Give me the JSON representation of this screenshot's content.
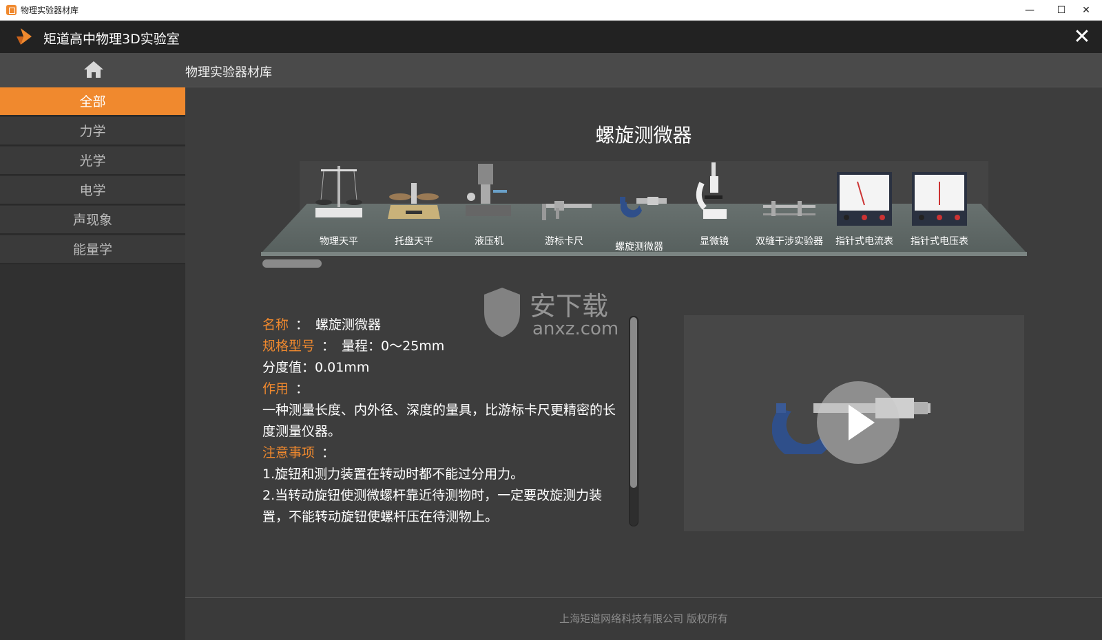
{
  "window": {
    "title": "物理实验器材库",
    "controls": [
      "minimize-icon",
      "maximize-icon",
      "close-icon"
    ]
  },
  "app": {
    "title": "矩道高中物理3D实验室",
    "close_icon": "close-icon"
  },
  "sidebar": {
    "home_icon": "home-icon",
    "categories": [
      {
        "label": "全部",
        "active": true
      },
      {
        "label": "力学",
        "active": false
      },
      {
        "label": "光学",
        "active": false
      },
      {
        "label": "电学",
        "active": false
      },
      {
        "label": "声现象",
        "active": false
      },
      {
        "label": "能量学",
        "active": false
      }
    ]
  },
  "breadcrumb": "物理实验器材库",
  "main": {
    "selected_title": "螺旋测微器",
    "equipment": [
      {
        "label": "物理天平",
        "icon": "balance-icon"
      },
      {
        "label": "托盘天平",
        "icon": "tray-balance-icon"
      },
      {
        "label": "液压机",
        "icon": "hydraulic-press-icon"
      },
      {
        "label": "游标卡尺",
        "icon": "vernier-caliper-icon"
      },
      {
        "label": "螺旋测微器",
        "icon": "micrometer-icon",
        "selected": true
      },
      {
        "label": "显微镜",
        "icon": "microscope-icon"
      },
      {
        "label": "双缝干涉实验器",
        "icon": "double-slit-icon"
      },
      {
        "label": "指针式电流表",
        "icon": "ammeter-icon"
      },
      {
        "label": "指针式电压表",
        "icon": "voltmeter-icon"
      }
    ],
    "info": {
      "name_label": "名称",
      "name_value": "螺旋测微器",
      "spec_label": "规格型号",
      "spec_value": "量程：0～25mm",
      "division": "分度值：0.01mm",
      "usage_label": "作用",
      "usage_text": "一种测量长度、内外径、深度的量具，比游标卡尺更精密的长度测量仪器。",
      "notes_label": "注意事项",
      "note1": "1.旋钮和测力装置在转动时都不能过分用力。",
      "note2": "2.当转动旋钮使测微螺杆靠近待测物时，一定要改旋测力装置，不能转动旋钮使螺杆压在待测物上。",
      "colon": "："
    },
    "watermark": {
      "text1": "安下载",
      "text2": "anxz.com"
    },
    "video": {
      "play_icon": "play-icon"
    }
  },
  "footer": "上海矩道网络科技有限公司  版权所有",
  "colors": {
    "accent": "#f0892e",
    "header": "#222222",
    "panel": "#3d3d3d"
  }
}
